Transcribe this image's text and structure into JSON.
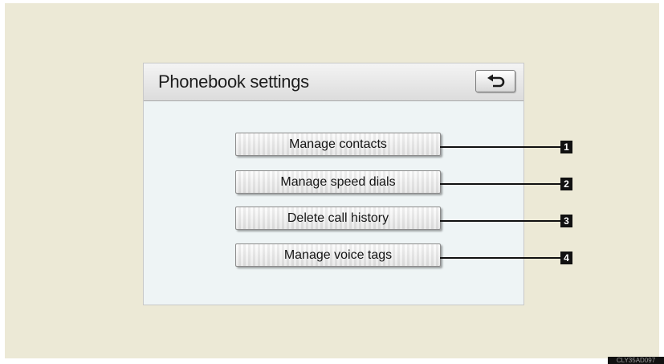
{
  "screen": {
    "title": "Phonebook settings",
    "back_icon": "back-arrow-icon"
  },
  "menu": {
    "items": [
      {
        "label": "Manage contacts",
        "callout": "1"
      },
      {
        "label": "Manage speed dials",
        "callout": "2"
      },
      {
        "label": "Delete call history",
        "callout": "3"
      },
      {
        "label": "Manage voice tags",
        "callout": "4"
      }
    ]
  },
  "image_code": "CLY35AD097",
  "colors": {
    "page_background": "#ece9d6",
    "screen_background": "#eef4f5",
    "callout": "#111111"
  }
}
